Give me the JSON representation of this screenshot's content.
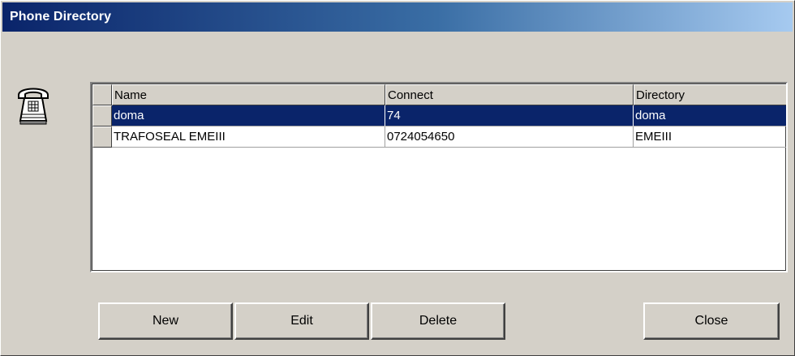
{
  "window": {
    "title": "Phone Directory"
  },
  "table": {
    "columns": [
      "Name",
      "Connect",
      "Directory"
    ],
    "rows": [
      {
        "name": "doma",
        "connect": "74",
        "directory": "doma",
        "selected": true
      },
      {
        "name": "TRAFOSEAL EMEIII",
        "connect": "0724054650",
        "directory": "EMEIII",
        "selected": false
      }
    ]
  },
  "buttons": {
    "new_label": "New",
    "edit_label": "Edit",
    "delete_label": "Delete",
    "close_label": "Close"
  },
  "icons": {
    "window_icon": "telephone-icon"
  },
  "colors": {
    "title_bar_start": "#0a246a",
    "title_bar_end": "#a6caf0",
    "selection": "#0a246a",
    "face": "#d4d0c8"
  }
}
